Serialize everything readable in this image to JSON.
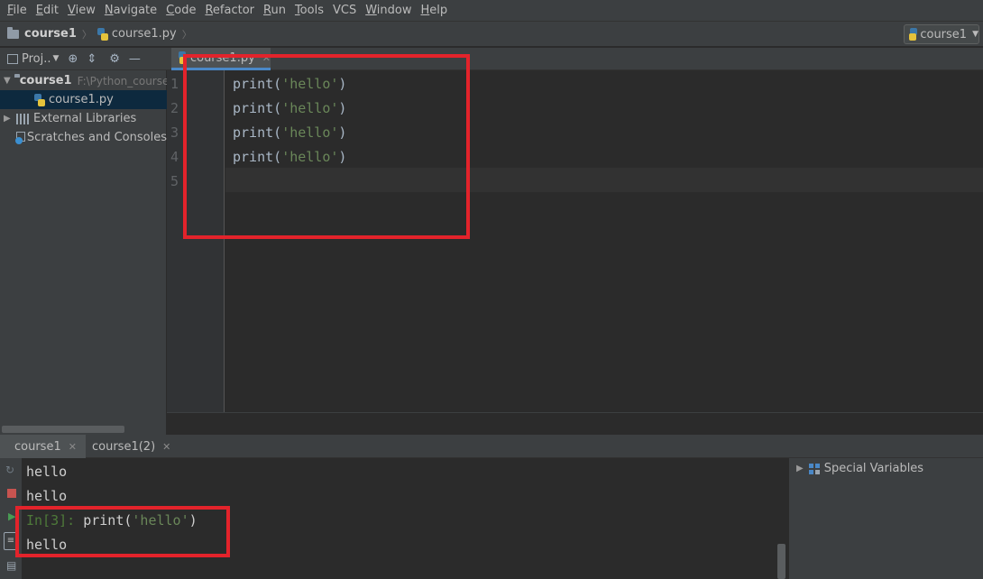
{
  "menu": [
    {
      "label": "File",
      "u": "F",
      "rest": "ile"
    },
    {
      "label": "Edit",
      "u": "E",
      "rest": "dit"
    },
    {
      "label": "View",
      "u": "V",
      "rest": "iew"
    },
    {
      "label": "Navigate",
      "u": "N",
      "rest": "avigate"
    },
    {
      "label": "Code",
      "u": "C",
      "rest": "ode"
    },
    {
      "label": "Refactor",
      "u": "R",
      "rest": "efactor"
    },
    {
      "label": "Run",
      "u": "R",
      "rest": "un"
    },
    {
      "label": "Tools",
      "u": "T",
      "rest": "ools"
    },
    {
      "label": "VCS",
      "u": "",
      "rest": "VCS"
    },
    {
      "label": "Window",
      "u": "W",
      "rest": "indow"
    },
    {
      "label": "Help",
      "u": "H",
      "rest": "elp"
    }
  ],
  "nav": {
    "project": "course1",
    "file": "course1.py",
    "run_config": "course1"
  },
  "project_panel": {
    "header": "Proj..",
    "root": {
      "name": "course1",
      "path": "F:\\Python_course"
    },
    "file": "course1.py",
    "external": "External Libraries",
    "scratches": "Scratches and Consoles"
  },
  "editor": {
    "tab": "course1.py",
    "line_numbers": [
      "1",
      "2",
      "3",
      "4",
      "5"
    ],
    "lines": [
      {
        "fn": "print",
        "open": "(",
        "str": "'hello'",
        "close": ")"
      },
      {
        "fn": "print",
        "open": "(",
        "str": "'hello'",
        "close": ")"
      },
      {
        "fn": "print",
        "open": "(",
        "str": "'hello'",
        "close": ")"
      },
      {
        "fn": "print",
        "open": "(",
        "str": "'hello'",
        "close": ")"
      }
    ]
  },
  "console": {
    "tabs": [
      "course1",
      "course1(2)"
    ],
    "output": [
      "hello",
      "hello"
    ],
    "prompt": "In[3]:",
    "command": " print(",
    "command_str": "'hello'",
    "command_close": ")",
    "result": "hello"
  },
  "variables": {
    "label": "Special Variables"
  },
  "colors": {
    "annotation": "#e3232b",
    "string": "#6a8759",
    "background": "#2b2b2b"
  }
}
